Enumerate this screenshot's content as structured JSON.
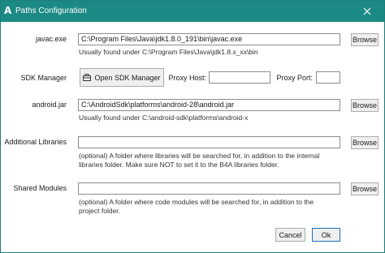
{
  "window": {
    "title": "Paths Configuration",
    "app_icon": "A"
  },
  "javac": {
    "label": "javac.exe",
    "value": "C:\\Program Files\\Java\\jdk1.8.0_191\\bin\\javac.exe",
    "hint": "Usually found under C:\\Program Files\\Java\\jdk1.8.x_xx\\bin",
    "browse_label": "Browse"
  },
  "sdk_manager": {
    "label": "SDK Manager",
    "button_label": "Open SDK Manager",
    "button_icon": "toolbox-icon",
    "proxy_host_label": "Proxy Host:",
    "proxy_host_value": "",
    "proxy_port_label": "Proxy Port:",
    "proxy_port_value": ""
  },
  "android_jar": {
    "label": "android.jar",
    "value": "C:\\AndroidSdk\\platforms\\android-28\\android.jar",
    "hint": "Usually found under C:\\android-sdk\\platforms\\android-x",
    "browse_label": "Browse"
  },
  "additional_libraries": {
    "label": "Additional Libraries",
    "value": "",
    "hint_line1": "(optional) A folder where libraries will be searched for, in addition to the internal",
    "hint_line2": "libraries folder. Make sure NOT to set it to the B4A libraries folder.",
    "browse_label": "Browse"
  },
  "shared_modules": {
    "label": "Shared Modules",
    "value": "",
    "hint_line1": "(optional) A folder where code modules will be searched for, in addition to the",
    "hint_line2": "project folder.",
    "browse_label": "Browse"
  },
  "footer": {
    "cancel_label": "Cancel",
    "ok_label": "Ok"
  }
}
